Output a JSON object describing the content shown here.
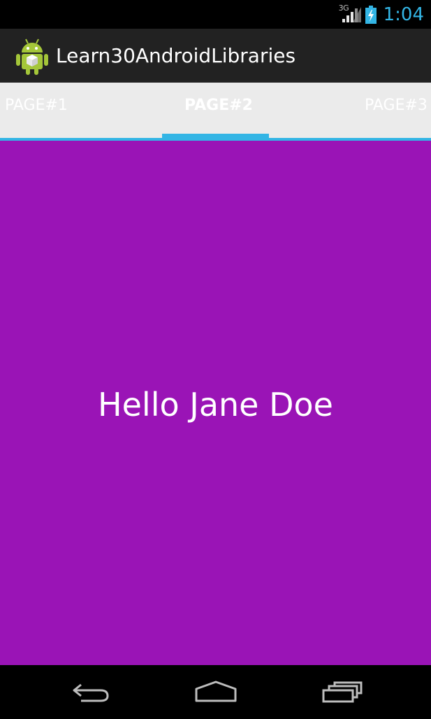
{
  "status_bar": {
    "network_type": "3G",
    "time": "1:04",
    "icons": [
      "signal-icon",
      "battery-charging-icon"
    ]
  },
  "action_bar": {
    "app_icon": "android-app-icon",
    "title": "Learn30AndroidLibraries"
  },
  "tabs": {
    "items": [
      {
        "label": "PAGE#1",
        "selected": false
      },
      {
        "label": "PAGE#2",
        "selected": true
      },
      {
        "label": "PAGE#3",
        "selected": false
      }
    ],
    "indicator_color": "#33b5e5"
  },
  "content": {
    "greeting": "Hello Jane Doe",
    "background_color": "#9a14b6"
  },
  "nav_bar": {
    "buttons": [
      "back-icon",
      "home-icon",
      "recents-icon"
    ]
  }
}
